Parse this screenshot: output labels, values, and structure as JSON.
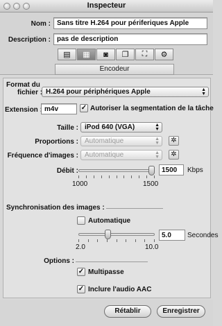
{
  "window": {
    "title": "Inspecteur"
  },
  "top": {
    "name_label": "Nom :",
    "name_value": "Sans titre H.264 pour périferiques Apple",
    "desc_label": "Description :",
    "desc_value": "pas de description",
    "active_tab": "Encodeur",
    "toolbar_icons": [
      "summary-icon",
      "encoder-icon",
      "frame-controls-icon",
      "filters-icon",
      "geometry-icon",
      "actions-icon"
    ]
  },
  "format": {
    "label_line1": "Format du",
    "label_line2": "fichier :",
    "value": "H.264 pour périphériques Apple"
  },
  "extension": {
    "label": "Extension :",
    "value": "m4v",
    "checkbox_label": "Autoriser la segmentation de la tâche",
    "checked": true
  },
  "video": {
    "size_label": "Taille :",
    "size_value": "iPod 640 (VGA)",
    "proportions_label": "Proportions :",
    "proportions_value": "Automatique",
    "framerate_label": "Fréquence d'images :",
    "framerate_value": "Automatique",
    "bitrate_label": "Débit :",
    "bitrate_value": "1500",
    "bitrate_unit": "Kbps",
    "bitrate_min": "1000",
    "bitrate_max": "1500",
    "bitrate_level": 1.0
  },
  "sync": {
    "label": "Synchronisation des images :",
    "auto_label": "Automatique",
    "auto_checked": false,
    "seconds_value": "5.0",
    "seconds_unit": "Secondes",
    "min": "2.0",
    "max": "10.0",
    "level": 0.375
  },
  "options": {
    "label": "Options :",
    "multipass_label": "Multipasse",
    "multipass_checked": true,
    "aac_label": "Inclure l'audio AAC",
    "aac_checked": true
  },
  "buttons": {
    "reset": "Rétablir",
    "save": "Enregistrer"
  }
}
